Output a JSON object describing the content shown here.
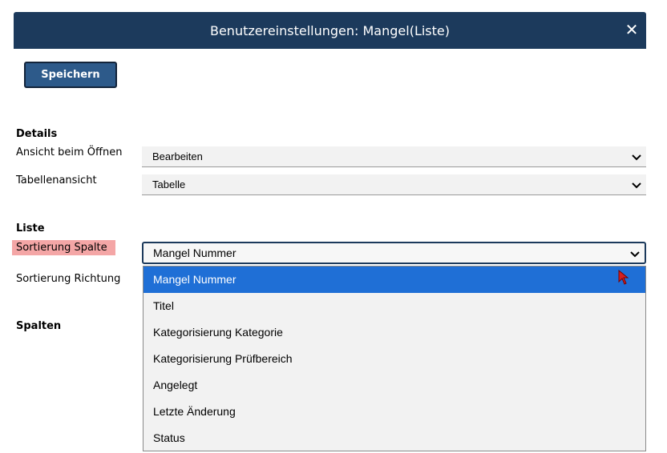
{
  "dialog": {
    "title": "Benutzereinstellungen: Mangel(Liste)",
    "close_icon": "close-icon",
    "save_label": "Speichern"
  },
  "details": {
    "heading": "Details",
    "open_view": {
      "label": "Ansicht beim Öffnen",
      "value": "Bearbeiten"
    },
    "table_view": {
      "label": "Tabellenansicht",
      "value": "Tabelle"
    }
  },
  "list": {
    "heading": "Liste",
    "sort_column": {
      "label": "Sortierung Spalte",
      "value": "Mangel Nummer"
    },
    "sort_direction": {
      "label": "Sortierung Richtung"
    }
  },
  "columns": {
    "heading": "Spalten"
  },
  "dropdown": {
    "options": [
      "Mangel Nummer",
      "Titel",
      "Kategorisierung Kategorie",
      "Kategorisierung Prüfbereich",
      "Angelegt",
      "Letzte Änderung",
      "Status"
    ],
    "selected_index": 0
  },
  "colors": {
    "header_bg": "#1c3a5c",
    "button_bg": "#2d5a8a",
    "highlight": "#f4a6a6",
    "selected_option": "#1f6fd6"
  }
}
